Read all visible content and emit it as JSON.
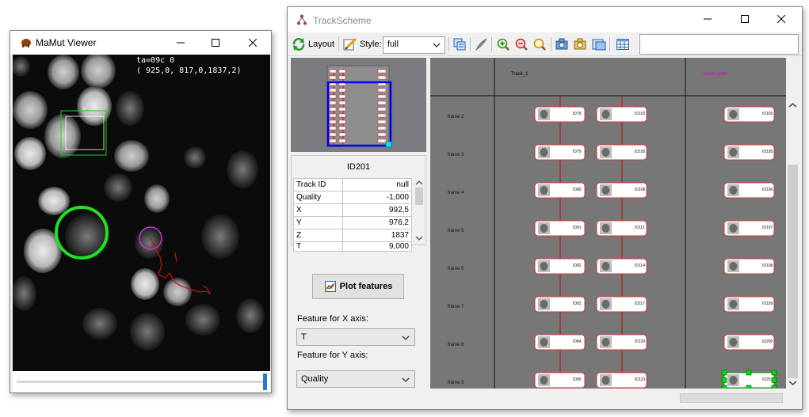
{
  "viewer_window": {
    "title": "MaMut Viewer",
    "overlay_line1": "ta=09c 0",
    "overlay_line2": "( 925,0, 817,0,1837,2)"
  },
  "trackscheme_window": {
    "title": "TrackScheme",
    "toolbar": {
      "layout_label": "Layout",
      "style_label": "Style:",
      "style_value": "full",
      "search_placeholder": ""
    },
    "info_panel": {
      "header": "ID201",
      "features": [
        {
          "name": "Track ID",
          "value": "null"
        },
        {
          "name": "Quality",
          "value": "-1,000"
        },
        {
          "name": "X",
          "value": "992,5"
        },
        {
          "name": "Y",
          "value": "976,2"
        },
        {
          "name": "Z",
          "value": "1837"
        },
        {
          "name": "T",
          "value": "9,000"
        }
      ]
    },
    "plot_button_label": "Plot features",
    "x_axis_label": "Feature for X axis:",
    "x_axis_value": "T",
    "y_axis_label": "Feature for Y axis:",
    "y_axis_value": "Quality",
    "scheme": {
      "columns": [
        {
          "header": "Track_1",
          "color": "#000000"
        },
        {
          "header": "Unlaid spots",
          "color": "#d400d4"
        }
      ],
      "rows": [
        {
          "frame": "frame 2",
          "spots": [
            "ID78",
            "ID102",
            "ID165"
          ]
        },
        {
          "frame": "frame 3",
          "spots": [
            "ID79",
            "ID105",
            "ID195"
          ]
        },
        {
          "frame": "frame 4",
          "spots": [
            "ID80",
            "ID108",
            "ID196"
          ]
        },
        {
          "frame": "frame 5",
          "spots": [
            "ID81",
            "ID111",
            "ID197"
          ]
        },
        {
          "frame": "frame 6",
          "spots": [
            "ID82",
            "ID114",
            "ID198"
          ]
        },
        {
          "frame": "frame 7",
          "spots": [
            "ID83",
            "ID117",
            "ID199"
          ]
        },
        {
          "frame": "frame 8",
          "spots": [
            "ID84",
            "ID120",
            "ID200"
          ]
        },
        {
          "frame": "frame 9",
          "spots": [
            "ID85",
            "ID123",
            "ID201"
          ]
        }
      ]
    }
  },
  "colors": {
    "spot_border": "#d23a3a",
    "link_line": "#cc0000",
    "selection": "#00dd00",
    "viewport_rect": "#0000ff",
    "timeline_thumb": "#1e7bd6"
  }
}
